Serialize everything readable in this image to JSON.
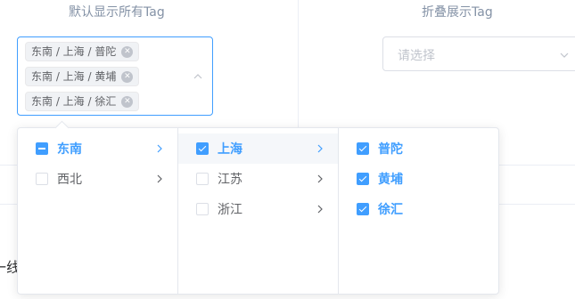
{
  "left_demo": {
    "caption": "默认显示所有Tag",
    "tags": [
      "东南 / 上海 / 普陀",
      "东南 / 上海 / 黄埔",
      "东南 / 上海 / 徐汇"
    ]
  },
  "right_demo": {
    "caption": "折叠展示Tag",
    "placeholder": "请选择"
  },
  "partial_text": "一线",
  "cascader_panel": {
    "menus": [
      {
        "items": [
          {
            "label": "东南",
            "state": "indeterminate",
            "has_children": true,
            "active": true
          },
          {
            "label": "西北",
            "state": "unchecked",
            "has_children": true,
            "active": false
          }
        ]
      },
      {
        "items": [
          {
            "label": "上海",
            "state": "checked",
            "has_children": true,
            "active": true
          },
          {
            "label": "江苏",
            "state": "unchecked",
            "has_children": true,
            "active": false
          },
          {
            "label": "浙江",
            "state": "unchecked",
            "has_children": true,
            "active": false
          }
        ]
      },
      {
        "items": [
          {
            "label": "普陀",
            "state": "checked",
            "has_children": false,
            "active": true
          },
          {
            "label": "黄埔",
            "state": "checked",
            "has_children": false,
            "active": true
          },
          {
            "label": "徐汇",
            "state": "checked",
            "has_children": false,
            "active": true
          }
        ]
      }
    ]
  },
  "colors": {
    "primary": "#409eff",
    "border": "#dcdfe6",
    "text": "#606266",
    "placeholder": "#c0c4cc"
  }
}
